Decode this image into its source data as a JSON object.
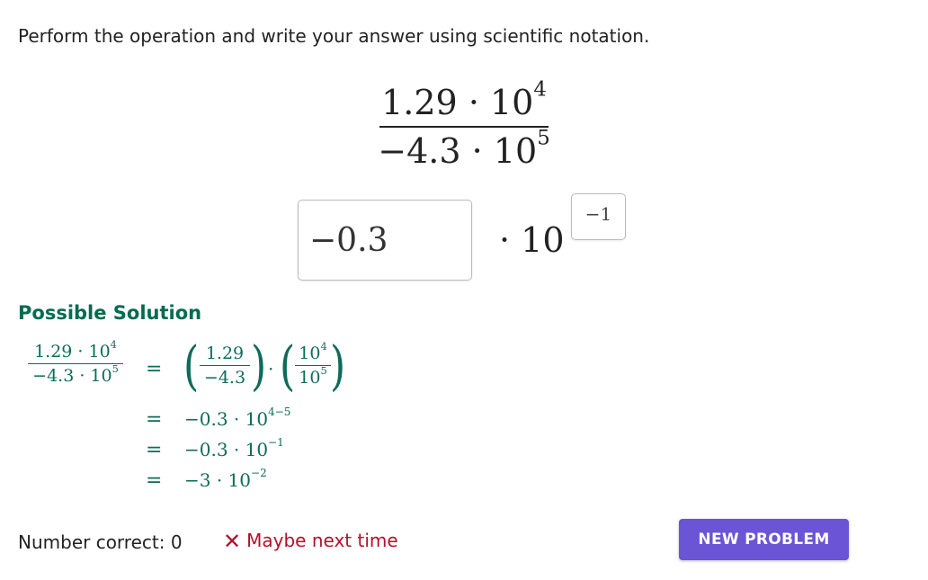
{
  "prompt": "Perform the operation and write your answer using scientific notation.",
  "problem": {
    "numerator": {
      "coef": "1.29",
      "dot": "·",
      "base": "10",
      "exp": "4"
    },
    "denominator": {
      "coef": "−4.3",
      "dot": "·",
      "base": "10",
      "exp": "5"
    }
  },
  "answer": {
    "coefficient_value": "−0.3",
    "times_ten": "· 10",
    "exponent_value": "−1"
  },
  "solution": {
    "title": "Possible Solution",
    "lhs": {
      "num_coef": "1.29 · 10",
      "num_exp": "4",
      "den_coef": "−4.3 · 10",
      "den_exp": "5"
    },
    "equals": "=",
    "step1": {
      "f1_num": "1.29",
      "f1_den": "−4.3",
      "dot": "·",
      "f2_num_base": "10",
      "f2_num_exp": "4",
      "f2_den_base": "10",
      "f2_den_exp": "5"
    },
    "step2": {
      "text": "−0.3 · 10",
      "exp": "4−5"
    },
    "step3": {
      "text": "−0.3 · 10",
      "exp": "−1"
    },
    "step4": {
      "text": "−3 · 10",
      "exp": "−2"
    }
  },
  "footer": {
    "count_label": "Number correct: 0",
    "feedback_icon": "✕",
    "feedback_text": "Maybe next time",
    "new_problem_label": "NEW PROBLEM"
  },
  "colors": {
    "accent": "#6b54d6",
    "solution": "#0e6b5a",
    "error": "#b0122b"
  }
}
